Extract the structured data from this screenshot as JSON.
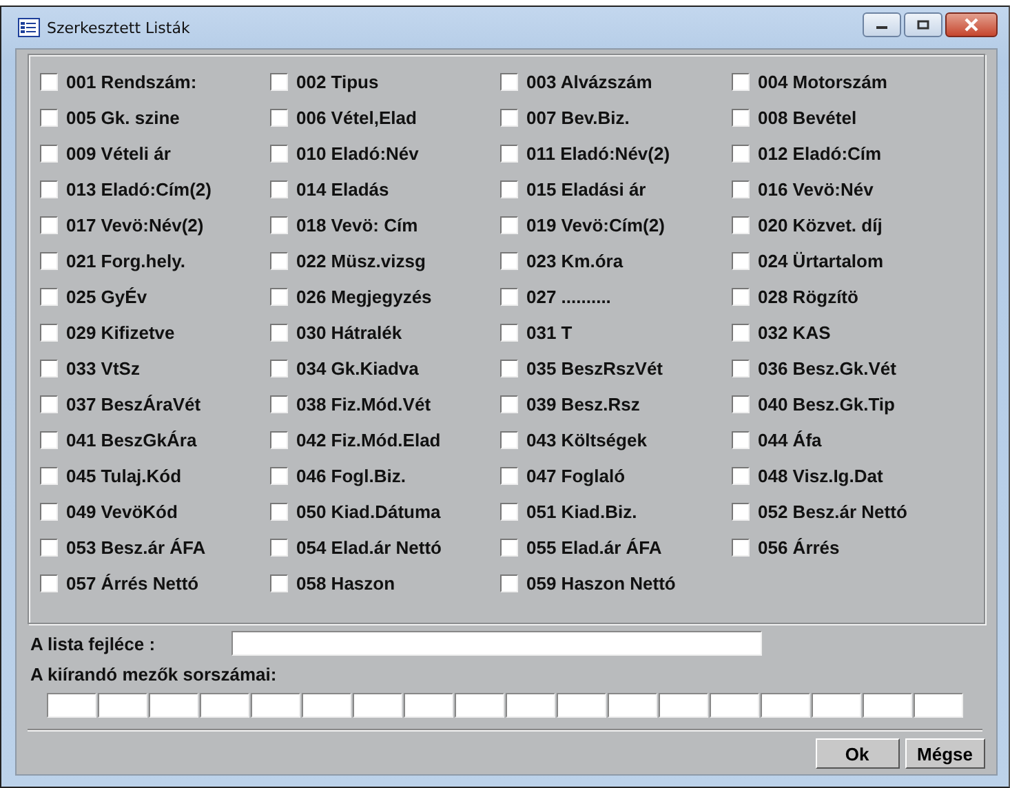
{
  "window": {
    "title": "Szerkesztett Listák"
  },
  "fields": [
    {
      "label": "001 Rendszám:",
      "checked": false
    },
    {
      "label": "002 Tipus",
      "checked": false
    },
    {
      "label": "003 Alvázszám",
      "checked": false
    },
    {
      "label": "004 Motorszám",
      "checked": false
    },
    {
      "label": "005 Gk. szine",
      "checked": false
    },
    {
      "label": "006 Vétel,Elad",
      "checked": false
    },
    {
      "label": "007 Bev.Biz.",
      "checked": false
    },
    {
      "label": "008 Bevétel",
      "checked": false
    },
    {
      "label": "009 Vételi ár",
      "checked": false
    },
    {
      "label": "010 Eladó:Név",
      "checked": false
    },
    {
      "label": "011 Eladó:Név(2)",
      "checked": false
    },
    {
      "label": "012 Eladó:Cím",
      "checked": false
    },
    {
      "label": "013 Eladó:Cím(2)",
      "checked": false
    },
    {
      "label": "014 Eladás",
      "checked": false
    },
    {
      "label": "015 Eladási ár",
      "checked": false
    },
    {
      "label": "016 Vevö:Név",
      "checked": false
    },
    {
      "label": "017 Vevö:Név(2)",
      "checked": false
    },
    {
      "label": "018 Vevö: Cím",
      "checked": false
    },
    {
      "label": "019 Vevö:Cím(2)",
      "checked": false
    },
    {
      "label": "020 Közvet. díj",
      "checked": false
    },
    {
      "label": "021 Forg.hely.",
      "checked": false
    },
    {
      "label": "022 Müsz.vizsg",
      "checked": false
    },
    {
      "label": "023 Km.óra",
      "checked": false
    },
    {
      "label": "024 Ürtartalom",
      "checked": false
    },
    {
      "label": "025 GyÉv",
      "checked": false
    },
    {
      "label": "026 Megjegyzés",
      "checked": false
    },
    {
      "label": "027 ..........",
      "checked": false
    },
    {
      "label": "028 Rögzítö",
      "checked": false
    },
    {
      "label": "029 Kifizetve",
      "checked": false
    },
    {
      "label": "030 Hátralék",
      "checked": false
    },
    {
      "label": "031 T",
      "checked": false
    },
    {
      "label": "032 KAS",
      "checked": false
    },
    {
      "label": "033 VtSz",
      "checked": false
    },
    {
      "label": "034 Gk.Kiadva",
      "checked": false
    },
    {
      "label": "035 BeszRszVét",
      "checked": false
    },
    {
      "label": "036 Besz.Gk.Vét",
      "checked": false
    },
    {
      "label": "037 BeszÁraVét",
      "checked": false
    },
    {
      "label": "038 Fiz.Mód.Vét",
      "checked": false
    },
    {
      "label": "039 Besz.Rsz",
      "checked": false
    },
    {
      "label": "040 Besz.Gk.Tip",
      "checked": false
    },
    {
      "label": "041 BeszGkÁra",
      "checked": false
    },
    {
      "label": "042 Fiz.Mód.Elad",
      "checked": false
    },
    {
      "label": "043 Költségek",
      "checked": false
    },
    {
      "label": "044 Áfa",
      "checked": false
    },
    {
      "label": "045 Tulaj.Kód",
      "checked": false
    },
    {
      "label": "046 Fogl.Biz.",
      "checked": false
    },
    {
      "label": "047 Foglaló",
      "checked": false
    },
    {
      "label": "048 Visz.Ig.Dat",
      "checked": false
    },
    {
      "label": "049 VevöKód",
      "checked": false
    },
    {
      "label": "050 Kiad.Dátuma",
      "checked": false
    },
    {
      "label": "051 Kiad.Biz.",
      "checked": false
    },
    {
      "label": "052 Besz.ár Nettó",
      "checked": false
    },
    {
      "label": "053 Besz.ár ÁFA",
      "checked": false
    },
    {
      "label": "054 Elad.ár Nettó",
      "checked": false
    },
    {
      "label": "055 Elad.ár ÁFA",
      "checked": false
    },
    {
      "label": "056 Árrés",
      "checked": false
    },
    {
      "label": "057 Árrés Nettó",
      "checked": false
    },
    {
      "label": "058 Haszon",
      "checked": false
    },
    {
      "label": "059 Haszon Nettó",
      "checked": false
    }
  ],
  "header_label": "A lista fejléce :",
  "order_label": "A kiírandó mezők sorszámai:",
  "buttons": [
    "Ok",
    "Mégse"
  ]
}
